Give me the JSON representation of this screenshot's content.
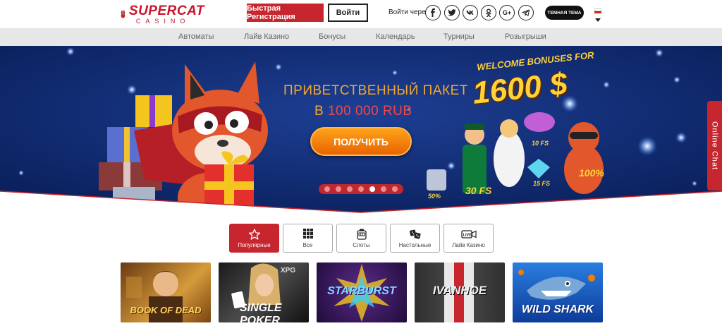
{
  "header": {
    "logo": {
      "main": "SUPERCAT",
      "sub": "CASINO"
    },
    "register_label": "Быстрая Регистрация",
    "login_label": "Войти",
    "social_label": "Войти через",
    "social_icons": [
      "facebook-icon",
      "twitter-icon",
      "vk-icon",
      "odnoklassniki-icon",
      "google-plus-icon",
      "telegram-icon"
    ],
    "dark_theme_label": "ТЕМНАЯ ТЕМА",
    "language": "ru"
  },
  "nav": {
    "items": [
      "Автоматы",
      "Лайв Казино",
      "Бонусы",
      "Календарь",
      "Турниры",
      "Розыгрыши"
    ]
  },
  "banner": {
    "title_line1": "ПРИВЕТСТВЕННЫЙ ПАКЕТ",
    "title_prefix": "В",
    "title_amount": "100 000 RUB",
    "cta_label": "ПОЛУЧИТЬ",
    "welcome_text": "WELCOME BONUSES FOR",
    "bonus_amount": "1600 $",
    "slides_count": 7,
    "active_slide": 5
  },
  "chat": {
    "label": "Online Chat"
  },
  "categories": [
    {
      "label": "Популярные",
      "icon": "star-icon",
      "active": true
    },
    {
      "label": "Все",
      "icon": "grid-icon",
      "active": false
    },
    {
      "label": "Слоты",
      "icon": "slot-machine-icon",
      "active": false
    },
    {
      "label": "Настольные",
      "icon": "dice-icon",
      "active": false
    },
    {
      "label": "Лайв Казино",
      "icon": "live-camera-icon",
      "active": false
    }
  ],
  "games": [
    {
      "title": "BOOK OF DEAD"
    },
    {
      "title": "SINGLE POKER"
    },
    {
      "title": "STARBURST"
    },
    {
      "title": "IVANHOE"
    },
    {
      "title": "WILD SHARK"
    }
  ],
  "colors": {
    "brand_red": "#c7262e",
    "banner_blue": "#0f2c72",
    "banner_gold": "#f4a82c",
    "cta_orange": "#f47d0a"
  }
}
